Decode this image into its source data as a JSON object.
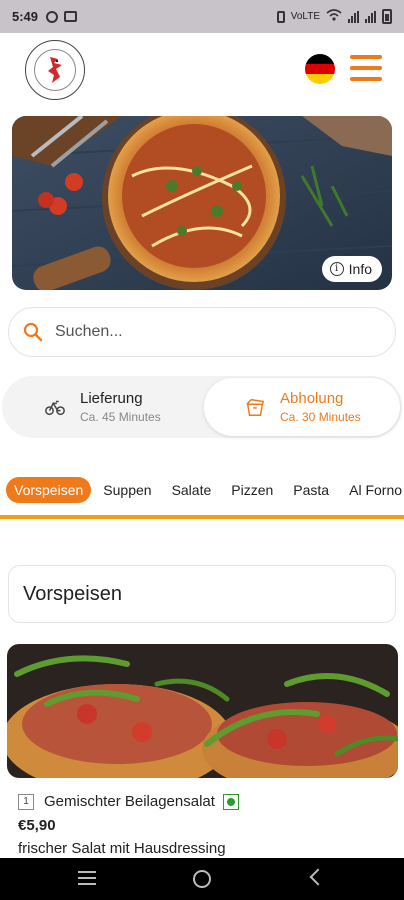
{
  "status_bar": {
    "time": "5:49",
    "network_text": "VoLTE",
    "icons": [
      "alarm-icon",
      "notification-icon",
      "vibrate-icon",
      "wifi-icon",
      "signal-icon",
      "battery-icon"
    ]
  },
  "header": {
    "logo_icon": "restaurant-logo-rooster",
    "language_flag": "germany-flag-icon",
    "menu_icon": "hamburger-menu-icon",
    "accent_color": "#ee7a1b"
  },
  "hero": {
    "image": "pizza-photo",
    "info_label": "Info"
  },
  "search": {
    "placeholder": "Suchen..."
  },
  "order_mode": {
    "delivery": {
      "label": "Lieferung",
      "time": "Ca. 45 Minutes",
      "icon": "bicycle-icon",
      "selected": false
    },
    "pickup": {
      "label": "Abholung",
      "time": "Ca. 30 Minutes",
      "icon": "takeaway-box-icon",
      "selected": true
    }
  },
  "categories": {
    "items": [
      "Vorspeisen",
      "Suppen",
      "Salate",
      "Pizzen",
      "Pasta",
      "Al Forno"
    ],
    "active": "Vorspeisen",
    "underline_color": "#f0a00e"
  },
  "section": {
    "title": "Vorspeisen"
  },
  "product": {
    "image": "bruschetta-photo",
    "number": "1",
    "name": "Gemischter Beilagensalat",
    "vegetarian": true,
    "price": "€5,90",
    "description": "frischer Salat mit Hausdressing"
  },
  "nav_bar": {
    "icons": [
      "recent-apps-icon",
      "home-icon",
      "back-icon"
    ]
  }
}
